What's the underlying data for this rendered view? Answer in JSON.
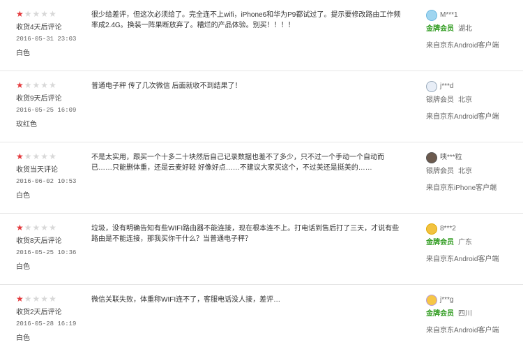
{
  "colors": {
    "star_on": "#e4393c",
    "star_off": "#d8d8d8",
    "gold_member": "#2f9b1f",
    "separator": "#e6e6e6"
  },
  "reviews": [
    {
      "rating": 1,
      "review_delay": "收货4天后评论",
      "date": "2016-05-31 23:03",
      "color": "白色",
      "content": "很少给差评，但这次必须给了。完全连不上wifi，iPhone6和华为P9都试过了。提示要修改路由工作频率成2.4G。换装一阵果断放弃了。糟烂的产品体验。别买！！！！",
      "user": {
        "name": "M***1",
        "level": "金牌会员",
        "location": "湖北",
        "device": "来自京东Android客户端",
        "avatar_icon": "avatar-icon"
      }
    },
    {
      "rating": 1,
      "review_delay": "收货9天后评论",
      "date": "2016-05-25 16:09",
      "color": "玫红色",
      "content": "普通电子秤 传了几次微信 后面就收不到结果了！",
      "user": {
        "name": "j***d",
        "level": "银牌会员",
        "location": "北京",
        "device": "来自京东Android客户端",
        "avatar_icon": "avatar-icon"
      }
    },
    {
      "rating": 1,
      "review_delay": "收货当天评论",
      "date": "2016-06-02 10:53",
      "color": "白色",
      "content": "不是太实用，跟买一个十多二十块然后自己记录数据也差不了多少，只不过一个手动一个自动而已……只能删体重，还是云麦好轻 好像好点……不建议大家买这个，不过美还是挺美的……",
      "user": {
        "name": "咦***粒",
        "level": "银牌会员",
        "location": "北京",
        "device": "来自京东iPhone客户端",
        "avatar_icon": "avatar-icon"
      }
    },
    {
      "rating": 1,
      "review_delay": "收货8天后评论",
      "date": "2016-05-25 10:36",
      "color": "白色",
      "content": "垃圾，没有明确告知有些WIFI路由器不能连接，现在根本连不上。打电话到售后打了三天，才说有些路由是不能连接，那我买你干什么？当普通电子秤？",
      "user": {
        "name": "8***2",
        "level": "金牌会员",
        "location": "广东",
        "device": "来自京东Android客户端",
        "avatar_icon": "avatar-icon"
      }
    },
    {
      "rating": 1,
      "review_delay": "收货2天后评论",
      "date": "2016-05-28 16:19",
      "color": "白色",
      "content": "微信关联失败，体重称WIFI连不了，客服电话没人接，差评…",
      "user": {
        "name": "j***g",
        "level": "金牌会员",
        "location": "四川",
        "device": "来自京东Android客户端",
        "avatar_icon": "avatar-icon"
      }
    }
  ]
}
